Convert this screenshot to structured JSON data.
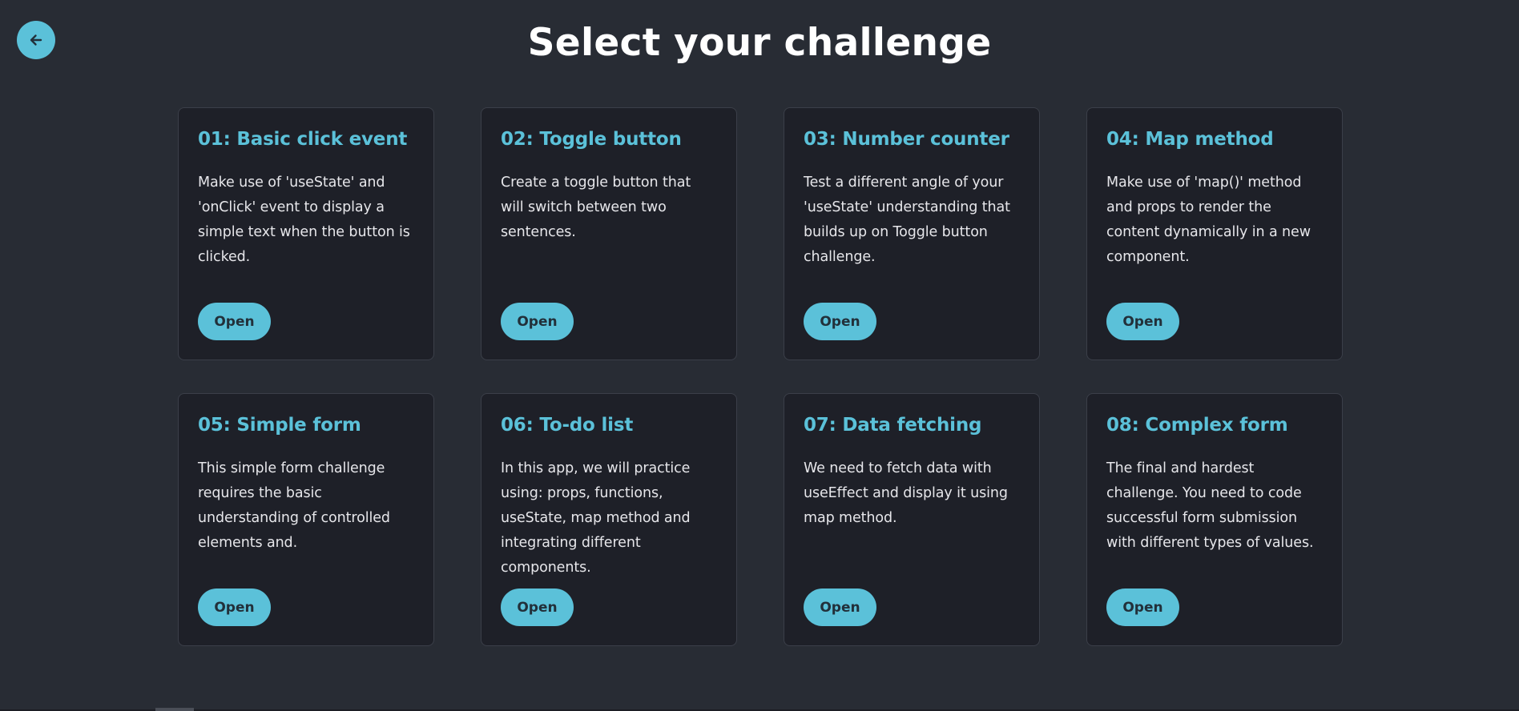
{
  "header": {
    "title": "Select your challenge",
    "back_icon": "arrow-left-icon"
  },
  "colors": {
    "background": "#282c34",
    "card_background": "#1e2028",
    "accent": "#5bc1d9",
    "title_text": "#ffffff",
    "body_text": "#e6e6ea"
  },
  "challenges": [
    {
      "title": "01: Basic click event",
      "description": "Make use of 'useState' and 'onClick' event to display a simple text when the button is clicked.",
      "button_label": "Open"
    },
    {
      "title": "02: Toggle button",
      "description": "Create a toggle button that will switch between two sentences.",
      "button_label": "Open"
    },
    {
      "title": "03: Number counter",
      "description": "Test a different angle of your 'useState' understanding that builds up on Toggle button challenge.",
      "button_label": "Open"
    },
    {
      "title": "04: Map method",
      "description": "Make use of 'map()' method and props to render the content dynamically in a new component.",
      "button_label": "Open"
    },
    {
      "title": "05: Simple form",
      "description": "This simple form challenge requires the basic understanding of controlled elements and.",
      "button_label": "Open"
    },
    {
      "title": "06: To-do list",
      "description": "In this app, we will practice using: props, functions, useState, map method and integrating different components.",
      "button_label": "Open"
    },
    {
      "title": "07: Data fetching",
      "description": "We need to fetch data with useEffect and display it using map method.",
      "button_label": "Open"
    },
    {
      "title": "08: Complex form",
      "description": "The final and hardest challenge. You need to code successful form submission with different types of values.",
      "button_label": "Open"
    }
  ]
}
